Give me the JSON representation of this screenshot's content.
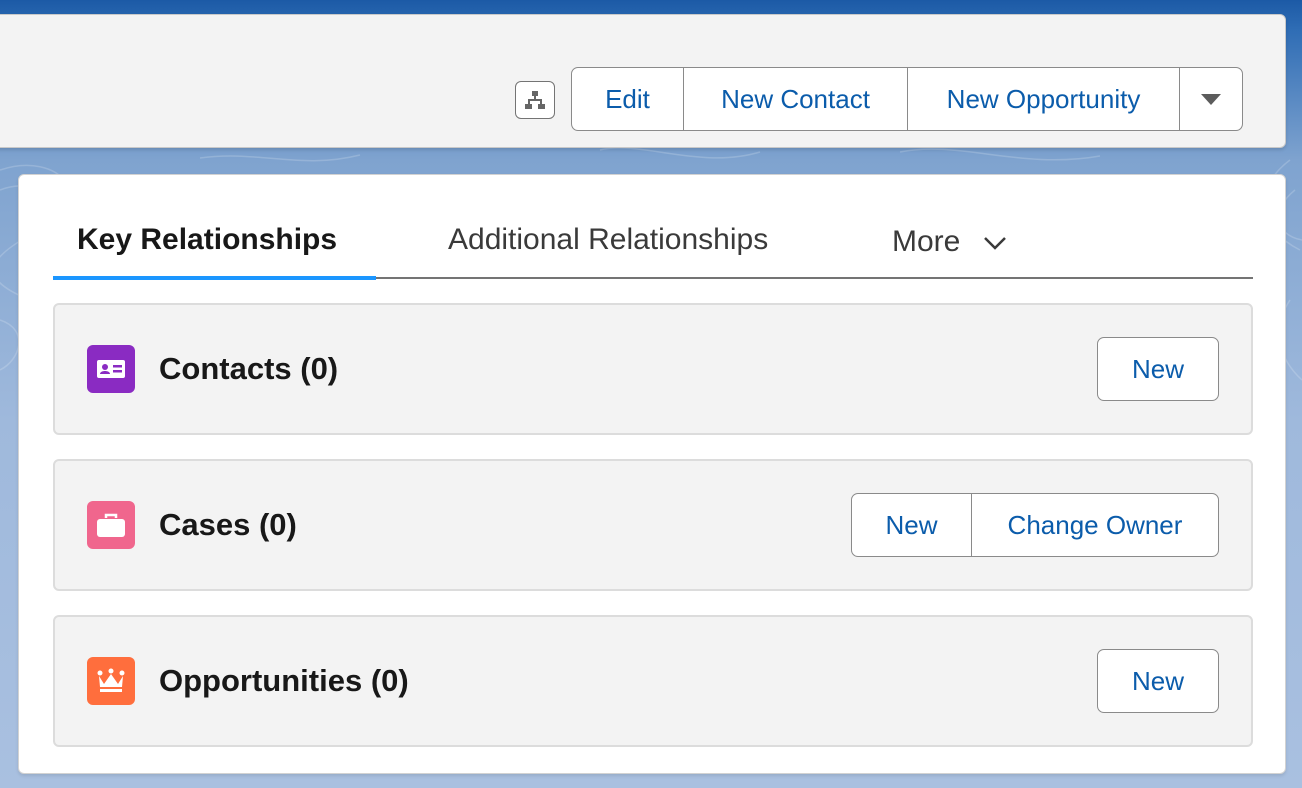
{
  "header": {
    "actions": [
      {
        "label": "Edit"
      },
      {
        "label": "New Contact"
      },
      {
        "label": "New Opportunity"
      }
    ]
  },
  "tabs": [
    {
      "label": "Key Relationships",
      "active": true
    },
    {
      "label": "Additional Relationships",
      "active": false
    },
    {
      "label": "More",
      "active": false
    }
  ],
  "cards": [
    {
      "title": "Contacts (0)",
      "icon": "contact-card-icon",
      "color": "#8a2bc2",
      "buttons": [
        "New"
      ]
    },
    {
      "title": "Cases (0)",
      "icon": "briefcase-icon",
      "color": "#f0668d",
      "buttons": [
        "New",
        "Change Owner"
      ]
    },
    {
      "title": "Opportunities (0)",
      "icon": "crown-icon",
      "color": "#ff6e3d",
      "buttons": [
        "New"
      ]
    }
  ],
  "colors": {
    "accent": "#1b96ff",
    "link": "#0b5cab"
  }
}
